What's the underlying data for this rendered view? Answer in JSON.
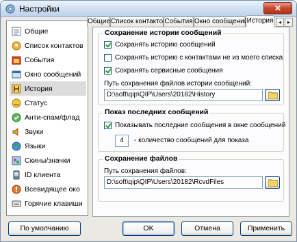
{
  "window": {
    "title": "Настройки",
    "close_glyph": "✕"
  },
  "sidebar": {
    "items": [
      {
        "label": "Общие",
        "icon": "checklist-icon"
      },
      {
        "label": "Список контактов",
        "icon": "contacts-icon"
      },
      {
        "label": "События",
        "icon": "events-icon"
      },
      {
        "label": "Окно сообщений",
        "icon": "message-window-icon"
      },
      {
        "label": "История",
        "icon": "history-icon"
      },
      {
        "label": "Статус",
        "icon": "status-icon"
      },
      {
        "label": "Анти-спам/флад",
        "icon": "antispam-icon"
      },
      {
        "label": "Звуки",
        "icon": "sounds-icon"
      },
      {
        "label": "Языки",
        "icon": "languages-icon"
      },
      {
        "label": "Скины/значки",
        "icon": "skins-icon"
      },
      {
        "label": "ID клиента",
        "icon": "client-id-icon"
      },
      {
        "label": "Всевидящее око",
        "icon": "all-seeing-eye-icon"
      },
      {
        "label": "Горячие клавиши",
        "icon": "hotkeys-icon"
      }
    ],
    "active_index": 4
  },
  "tabs": {
    "items": [
      "Общие",
      "Список контактов",
      "События",
      "Окно сообщений",
      "История"
    ],
    "active_index": 4,
    "scroll_left": "◂",
    "scroll_right": "▸"
  },
  "history_save": {
    "title": "Сохранение истории сообщений",
    "options": [
      {
        "label": "Сохранять историю сообщений",
        "checked": true
      },
      {
        "label": "Сохранять историю с контактами не из моего списка",
        "checked": false
      },
      {
        "label": "Сохранять сервисные сообщения",
        "checked": true
      }
    ],
    "path_label": "Путь сохранения файлов истории сообщений:",
    "path_value": "D:\\soft\\qip\\QIP\\Users\\20182\\History"
  },
  "recent_messages": {
    "title": "Показ последних сообщений",
    "option": {
      "label": "Показывать последние сообщения в окне сообщений",
      "checked": true
    },
    "count_value": "4",
    "count_label": "- количество сообщений для показа"
  },
  "file_save": {
    "title": "Сохранение файлов",
    "path_label": "Путь сохранения файлов:",
    "path_value": "D:\\soft\\qip\\QIP\\Users\\20182\\RcvdFiles"
  },
  "buttons": {
    "defaults": "По умолчанию",
    "ok": "OK",
    "cancel": "Отмена",
    "apply": "Применить"
  }
}
